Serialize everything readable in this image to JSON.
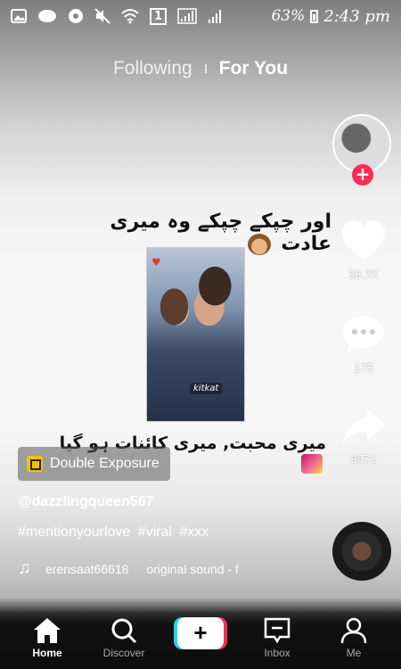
{
  "status_bar": {
    "battery_percent": "63%",
    "time": "2:43 pm",
    "sim_indicator": "1",
    "icons": [
      "gallery-icon",
      "chat-icon",
      "settings-badge-icon",
      "mute-icon",
      "wifi-icon",
      "signal-icon",
      "signal-icon",
      "battery-charging-icon"
    ]
  },
  "top_tabs": {
    "following": "Following",
    "for_you": "For You",
    "active": "For You"
  },
  "video": {
    "overlay_line_1": "اور چپکے چپکے وہ میری عادت",
    "overlay_line_2": "میری محبت, میری کائنات ہو گیا",
    "photo_sticker": "kitkat"
  },
  "side_actions": {
    "like_count": "38.7K",
    "comment_count": "175",
    "share_count": "9071"
  },
  "effect": {
    "label": "Double Exposure"
  },
  "post": {
    "username": "@dazzlingqueen567",
    "hashtags": [
      "#mentionyourlove",
      "#viral",
      "#xxx"
    ],
    "sound_user": "erensaat66618",
    "sound_title": "original sound - f"
  },
  "bottom_nav": {
    "home": "Home",
    "discover": "Discover",
    "inbox": "Inbox",
    "me": "Me",
    "active": "Home"
  },
  "colors": {
    "accent_red": "#fe2c55",
    "accent_cyan": "#20d5ec",
    "effect_yellow": "#f2c200"
  }
}
